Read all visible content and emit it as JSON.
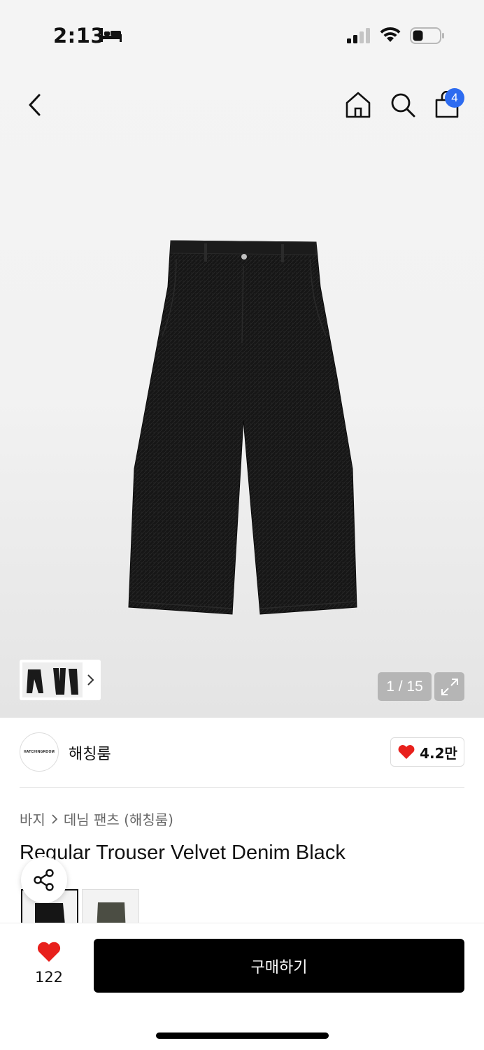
{
  "status_bar": {
    "time": "2:13",
    "icons": [
      "bed-icon",
      "signal-icon",
      "wifi-icon",
      "battery-icon"
    ]
  },
  "top_nav": {
    "icons": [
      "back-icon",
      "home-icon",
      "search-icon",
      "shopping-bag-icon"
    ],
    "cart_count": "4",
    "badge_color": "#2d6bf0"
  },
  "gallery": {
    "counter": "1 / 15",
    "current": 1,
    "total": 15
  },
  "brand": {
    "logo_text": "HATCHINGROOM",
    "name": "해칭룸",
    "like_count": "4.2만"
  },
  "breadcrumb": {
    "category": "바지",
    "subcategory": "데님 팬츠 (해칭룸)"
  },
  "product": {
    "title": "Regular Trouser Velvet Denim Black",
    "variants": [
      "black",
      "olive"
    ]
  },
  "bottom_bar": {
    "like_count": "122",
    "buy_label": "구매하기",
    "heart_color": "#e8201c"
  }
}
